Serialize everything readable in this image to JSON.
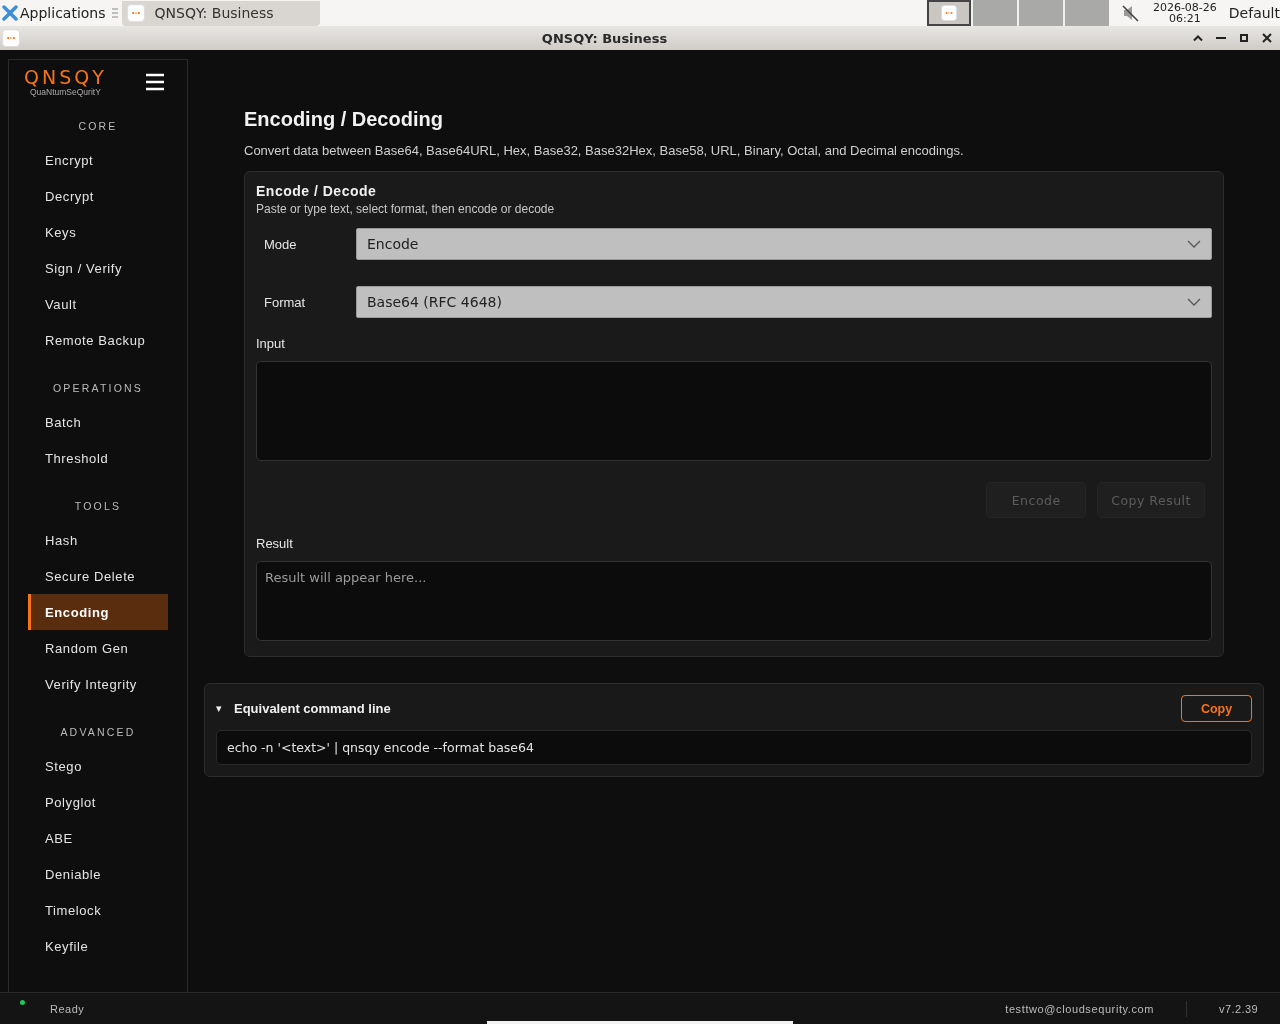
{
  "taskbar": {
    "launcher": "Applications",
    "task": "QNSQY: Business",
    "workspaces": [
      {
        "selected": true
      },
      {
        "selected": false
      },
      {
        "selected": false
      },
      {
        "selected": false
      }
    ],
    "muted": true,
    "date": "2026-08-26",
    "time": "06:21",
    "user": "Default"
  },
  "window": {
    "title": "QNSQY: Business"
  },
  "sidebar": {
    "logo": "QNSQY",
    "tagline": "QuaNtumSeQuritY",
    "sections": [
      {
        "title": "CORE",
        "items": [
          {
            "label": "Encrypt",
            "selected": false
          },
          {
            "label": "Decrypt",
            "selected": false
          },
          {
            "label": "Keys",
            "selected": false
          },
          {
            "label": "Sign / Verify",
            "selected": false
          },
          {
            "label": "Vault",
            "selected": false
          },
          {
            "label": "Remote Backup",
            "selected": false
          }
        ]
      },
      {
        "title": "OPERATIONS",
        "items": [
          {
            "label": "Batch",
            "selected": false
          },
          {
            "label": "Threshold",
            "selected": false
          }
        ]
      },
      {
        "title": "TOOLS",
        "items": [
          {
            "label": "Hash",
            "selected": false
          },
          {
            "label": "Secure Delete",
            "selected": false
          },
          {
            "label": "Encoding",
            "selected": true
          },
          {
            "label": "Random Gen",
            "selected": false
          },
          {
            "label": "Verify Integrity",
            "selected": false
          }
        ]
      },
      {
        "title": "ADVANCED",
        "items": [
          {
            "label": "Stego",
            "selected": false
          },
          {
            "label": "Polyglot",
            "selected": false
          },
          {
            "label": "ABE",
            "selected": false
          },
          {
            "label": "Deniable",
            "selected": false
          },
          {
            "label": "Timelock",
            "selected": false
          },
          {
            "label": "Keyfile",
            "selected": false
          }
        ]
      }
    ]
  },
  "page": {
    "title": "Encoding / Decoding",
    "subtitle": "Convert data between Base64, Base64URL, Hex, Base32, Base32Hex, Base58, URL, Binary, Octal, and Decimal encodings."
  },
  "card": {
    "title": "Encode / Decode",
    "hint": "Paste or type text, select format, then encode or decode",
    "fields": [
      {
        "label": "Mode",
        "value": "Encode"
      },
      {
        "label": "Format",
        "value": "Base64 (RFC 4648)"
      }
    ],
    "input": {
      "label": "Input"
    },
    "buttons": [
      {
        "label": "Encode",
        "disabled": true
      },
      {
        "label": "Copy Result",
        "disabled": true
      }
    ],
    "result": {
      "label": "Result",
      "placeholder": "Result will appear here..."
    }
  },
  "command": {
    "toggle": "▾",
    "title": "Equivalent command line",
    "expanded": true,
    "copy": "Copy",
    "text": "echo -n '<text>' | qnsqy encode --format base64"
  },
  "status_bar": {
    "color": "#22c55e",
    "text": "Ready",
    "user": "testtwo@cloudsequrity.com",
    "version": "v7.2.39"
  }
}
